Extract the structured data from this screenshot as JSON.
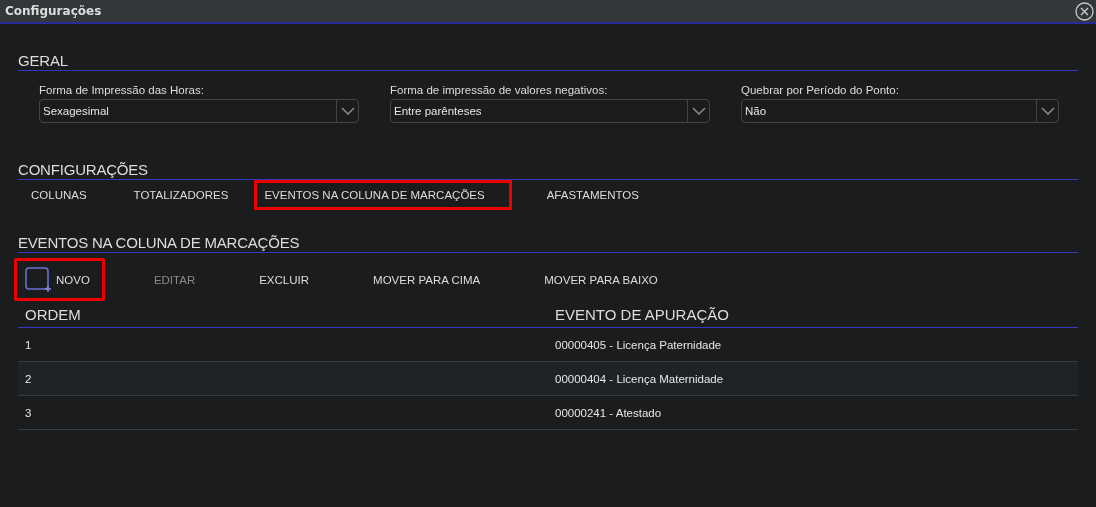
{
  "window": {
    "title": "Configurações"
  },
  "geral": {
    "title": "GERAL",
    "fields": [
      {
        "label": "Forma de Impressão das Horas:",
        "value": "Sexagesimal"
      },
      {
        "label": "Forma de impressão de valores negativos:",
        "value": "Entre parênteses"
      },
      {
        "label": "Quebrar por Período do Ponto:",
        "value": "Não"
      }
    ]
  },
  "configuracoes": {
    "title": "CONFIGURAÇÕES",
    "tabs": [
      {
        "label": "COLUNAS",
        "highlighted": false
      },
      {
        "label": "TOTALIZADORES",
        "highlighted": false
      },
      {
        "label": "EVENTOS NA COLUNA DE MARCAÇÕES",
        "highlighted": true
      },
      {
        "label": "AFASTAMENTOS",
        "highlighted": false
      }
    ]
  },
  "eventos": {
    "title": "EVENTOS NA COLUNA DE MARCAÇÕES",
    "toolbar": [
      {
        "label": "NOVO",
        "kind": "add",
        "disabled": false,
        "highlighted": true
      },
      {
        "label": "EDITAR",
        "kind": "text",
        "disabled": true,
        "highlighted": false
      },
      {
        "label": "EXCLUIR",
        "kind": "text",
        "disabled": false,
        "highlighted": false
      },
      {
        "label": "MOVER PARA CIMA",
        "kind": "text",
        "disabled": false,
        "highlighted": false
      },
      {
        "label": "MOVER PARA BAIXO",
        "kind": "text",
        "disabled": false,
        "highlighted": false
      }
    ],
    "table": {
      "columns": [
        "ORDEM",
        "EVENTO DE APURAÇÃO"
      ],
      "rows": [
        [
          "1",
          "00000405 - Licença Paternidade"
        ],
        [
          "2",
          "00000404 - Licença Maternidade"
        ],
        [
          "3",
          "00000241 - Atestado"
        ]
      ]
    }
  }
}
